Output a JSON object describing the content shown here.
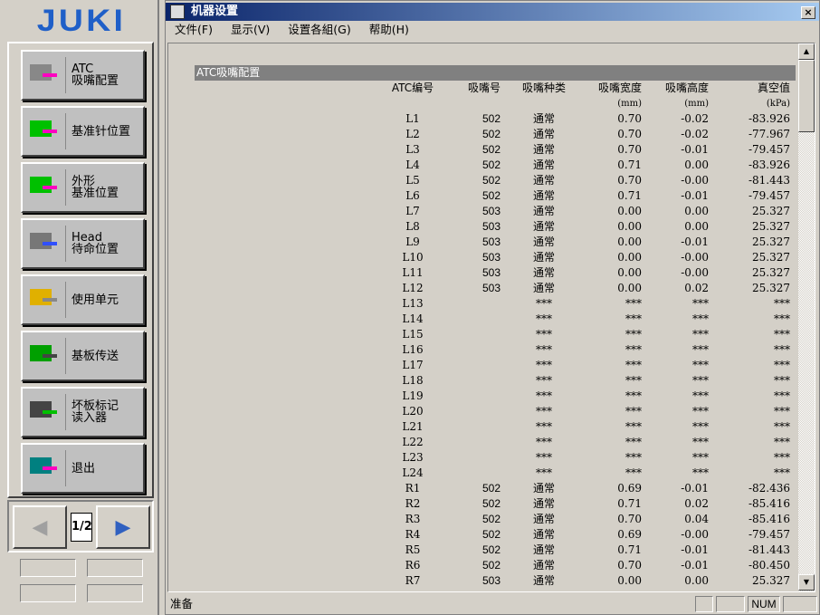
{
  "logo": "JUKI",
  "sidebar": {
    "buttons": [
      {
        "label": "ATC\n吸嘴配置",
        "icon": "atc-nozzle-icon"
      },
      {
        "label": "基准针位置",
        "icon": "reference-pin-icon"
      },
      {
        "label": "外形\n基准位置",
        "icon": "outline-reference-icon"
      },
      {
        "label": "Head\n待命位置",
        "icon": "head-standby-icon"
      },
      {
        "label": "使用单元",
        "icon": "unit-icon"
      },
      {
        "label": "基板传送",
        "icon": "board-transfer-icon"
      },
      {
        "label": "坏板标记\n读入器",
        "icon": "bad-mark-reader-icon"
      },
      {
        "label": "退出",
        "icon": "exit-door-icon"
      }
    ],
    "page": "1/2"
  },
  "window": {
    "title": "机器设置",
    "close": "×"
  },
  "menu": [
    "文件(F)",
    "显示(V)",
    "设置各組(G)",
    "帮助(H)"
  ],
  "section": "ATC吸嘴配置",
  "table": {
    "headers": [
      "ATC编号",
      "吸嘴号",
      "吸嘴种类",
      "吸嘴宽度",
      "吸嘴高度",
      "真空值"
    ],
    "units": [
      "",
      "",
      "",
      "(mm)",
      "(mm)",
      "(kPa)"
    ],
    "rows": [
      [
        "L1",
        "502",
        "通常",
        "0.70",
        "-0.02",
        "-83.926"
      ],
      [
        "L2",
        "502",
        "通常",
        "0.70",
        "-0.02",
        "-77.967"
      ],
      [
        "L3",
        "502",
        "通常",
        "0.70",
        "-0.01",
        "-79.457"
      ],
      [
        "L4",
        "502",
        "通常",
        "0.71",
        "0.00",
        "-83.926"
      ],
      [
        "L5",
        "502",
        "通常",
        "0.70",
        "-0.00",
        "-81.443"
      ],
      [
        "L6",
        "502",
        "通常",
        "0.71",
        "-0.01",
        "-79.457"
      ],
      [
        "L7",
        "503",
        "通常",
        "0.00",
        "0.00",
        "25.327"
      ],
      [
        "L8",
        "503",
        "通常",
        "0.00",
        "0.00",
        "25.327"
      ],
      [
        "L9",
        "503",
        "通常",
        "0.00",
        "-0.01",
        "25.327"
      ],
      [
        "L10",
        "503",
        "通常",
        "0.00",
        "-0.00",
        "25.327"
      ],
      [
        "L11",
        "503",
        "通常",
        "0.00",
        "-0.00",
        "25.327"
      ],
      [
        "L12",
        "503",
        "通常",
        "0.00",
        "0.02",
        "25.327"
      ],
      [
        "L13",
        "",
        "***",
        "***",
        "***",
        "***"
      ],
      [
        "L14",
        "",
        "***",
        "***",
        "***",
        "***"
      ],
      [
        "L15",
        "",
        "***",
        "***",
        "***",
        "***"
      ],
      [
        "L16",
        "",
        "***",
        "***",
        "***",
        "***"
      ],
      [
        "L17",
        "",
        "***",
        "***",
        "***",
        "***"
      ],
      [
        "L18",
        "",
        "***",
        "***",
        "***",
        "***"
      ],
      [
        "L19",
        "",
        "***",
        "***",
        "***",
        "***"
      ],
      [
        "L20",
        "",
        "***",
        "***",
        "***",
        "***"
      ],
      [
        "L21",
        "",
        "***",
        "***",
        "***",
        "***"
      ],
      [
        "L22",
        "",
        "***",
        "***",
        "***",
        "***"
      ],
      [
        "L23",
        "",
        "***",
        "***",
        "***",
        "***"
      ],
      [
        "L24",
        "",
        "***",
        "***",
        "***",
        "***"
      ],
      [
        "R1",
        "502",
        "通常",
        "0.69",
        "-0.01",
        "-82.436"
      ],
      [
        "R2",
        "502",
        "通常",
        "0.71",
        "0.02",
        "-85.416"
      ],
      [
        "R3",
        "502",
        "通常",
        "0.70",
        "0.04",
        "-85.416"
      ],
      [
        "R4",
        "502",
        "通常",
        "0.69",
        "-0.00",
        "-79.457"
      ],
      [
        "R5",
        "502",
        "通常",
        "0.71",
        "-0.01",
        "-81.443"
      ],
      [
        "R6",
        "502",
        "通常",
        "0.70",
        "-0.01",
        "-80.450"
      ],
      [
        "R7",
        "503",
        "通常",
        "0.00",
        "0.00",
        "25.327"
      ]
    ]
  },
  "status": {
    "text": "准备",
    "num": "NUM"
  },
  "colors": {
    "logo": "#1f5fc8",
    "titlebar": "#0a246a",
    "section": "#808080"
  }
}
